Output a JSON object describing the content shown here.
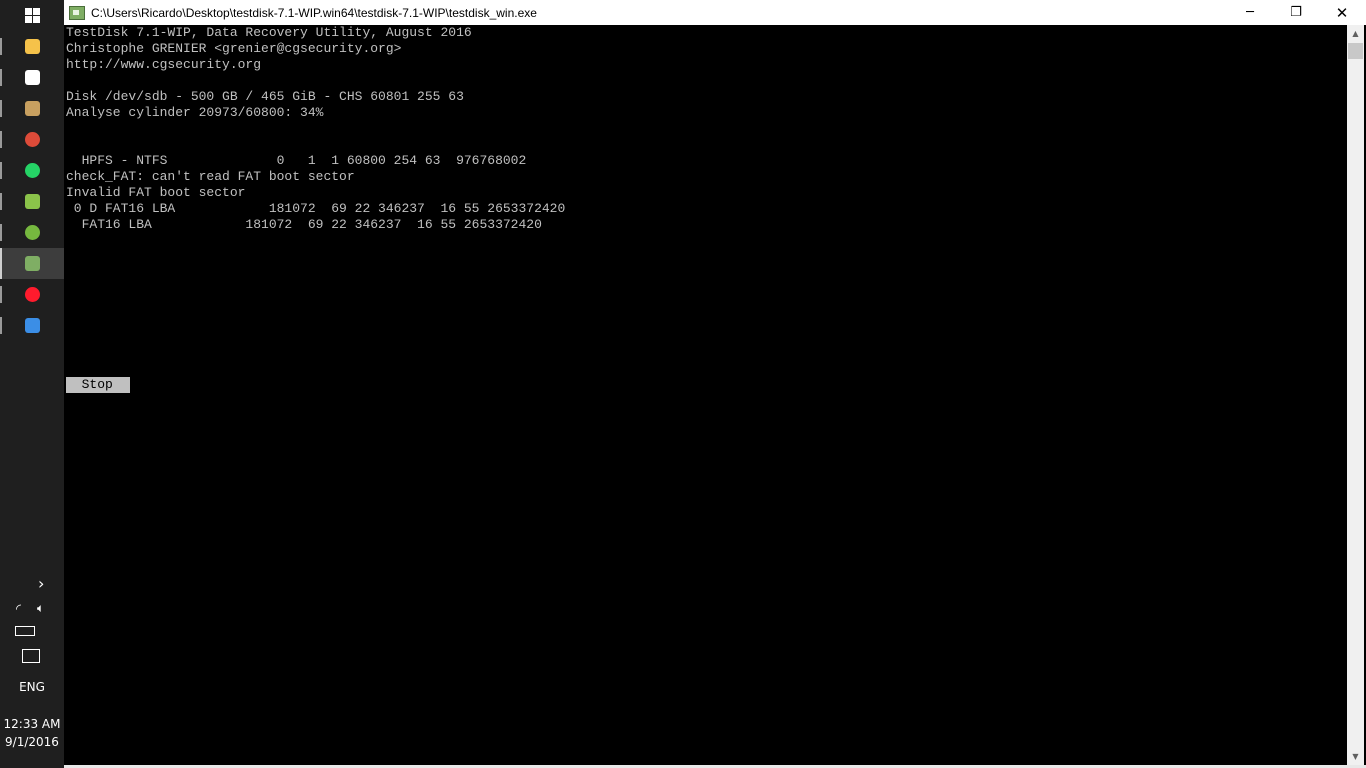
{
  "taskbar": {
    "pinned": [
      {
        "icon": "file-explorer-icon",
        "color": "#f5c24a",
        "label": "File Explorer"
      },
      {
        "icon": "store-icon",
        "color": "#ffffff",
        "label": "Store"
      },
      {
        "icon": "photo-app-icon",
        "color": "#c8a060",
        "label": "Photo"
      },
      {
        "icon": "chrome-icon",
        "color": "#dd4b39",
        "label": "Chrome"
      },
      {
        "icon": "whatsapp-icon",
        "color": "#25d366",
        "label": "WhatsApp"
      },
      {
        "icon": "stack-app-icon",
        "color": "#8bc34a",
        "label": "App"
      },
      {
        "icon": "utorrent-icon",
        "color": "#76b83f",
        "label": "uTorrent"
      },
      {
        "icon": "testdisk-icon",
        "color": "#7fae64",
        "label": "TestDisk"
      },
      {
        "icon": "opera-icon",
        "color": "#ff1b2d",
        "label": "Opera"
      },
      {
        "icon": "network-app-icon",
        "color": "#3b8ee6",
        "label": "App"
      }
    ],
    "language": "ENG",
    "time": "12:33 AM",
    "date": "9/1/2016"
  },
  "window": {
    "title": "C:\\Users\\Ricardo\\Desktop\\testdisk-7.1-WIP.win64\\testdisk-7.1-WIP\\testdisk_win.exe",
    "minimize_glyph": "─",
    "maximize_glyph": "❐",
    "close_glyph": "✕"
  },
  "console": {
    "lines": [
      "TestDisk 7.1-WIP, Data Recovery Utility, August 2016",
      "Christophe GRENIER <grenier@cgsecurity.org>",
      "http://www.cgsecurity.org",
      "",
      "Disk /dev/sdb - 500 GB / 465 GiB - CHS 60801 255 63",
      "Analyse cylinder 20973/60800: 34%",
      "",
      "",
      "  HPFS - NTFS              0   1  1 60800 254 63  976768002",
      "check_FAT: can't read FAT boot sector",
      "Invalid FAT boot sector",
      " 0 D FAT16 LBA            181072  69 22 346237  16 55 2653372420",
      "  FAT16 LBA            181072  69 22 346237  16 55 2653372420"
    ],
    "stop_label": "  Stop  "
  }
}
